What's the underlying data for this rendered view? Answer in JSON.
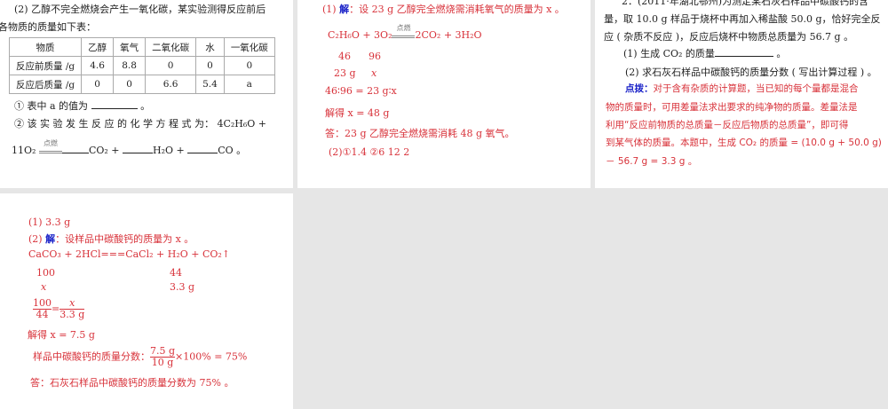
{
  "p1": {
    "intro": "(2) 乙醇不完全燃烧会产生一氧化碳，某实验测得反应前后",
    "intro2": "各物质的质量如下表：",
    "table": {
      "headers": [
        "物质",
        "乙醇",
        "氧气",
        "二氧化碳",
        "水",
        "一氧化碳"
      ],
      "rows": [
        [
          "反应前质量 /g",
          "4.6",
          "8.8",
          "0",
          "0",
          "0"
        ],
        [
          "反应后质量 /g",
          "0",
          "0",
          "6.6",
          "5.4",
          "a"
        ]
      ]
    },
    "q1": "① 表中  a  的值为",
    "q1_end": "。",
    "q2": "②  该  实  验  发  生  反  应  的  化  学  方  程  式  为：  4C₂H₆O  +",
    "cond": "点燃",
    "eq_start": "11O₂",
    "eq_co2": "CO₂ +",
    "eq_h2o": "H₂O +",
    "eq_co": "CO 。"
  },
  "p2": {
    "l1_pre": "(1) ",
    "l1_jie": "解",
    "l1": "：设  23 g  乙醇完全燃烧需消耗氧气的质量为  x 。",
    "eq_left": "C₂H₆O + 3O₂",
    "cond": "点燃",
    "eq_right": "2CO₂ + 3H₂O",
    "r1a": "46",
    "r1b": "96",
    "r2a": "23 g",
    "r2b": "x",
    "ratio": "46∶96 = 23 g∶x",
    "solve": "解得  x = 48 g",
    "ans": "答：23 g  乙醇完全燃烧需消耗  48 g  氧气。",
    "p2": "(2)①1.4    ②6    12    2"
  },
  "p3": {
    "l0": "2．(2011·年湖北鄂州)为测定某石灰石样品中碳酸钙的含",
    "l1": "量，取  10.0 g  样品于烧杯中再加入稀盐酸  50.0 g，恰好完全反",
    "l2": "应 ( 杂质不反应 )，反应后烧杯中物质总质量为  56.7 g 。",
    "q1": "(1) 生成  CO₂ 的质量",
    "q1_end": "。",
    "q2": "(2) 求石灰石样品中碳酸钙的质量分数 ( 写出计算过程 ) 。",
    "hint_label": "点拨：",
    "h1": "对于含有杂质的计算题，当已知的每个量都是混合",
    "h2": "物的质量时，可用差量法求出要求的纯净物的质量。差量法是",
    "h3": "利用“反应前物质的总质量－反应后物质的总质量”，即可得",
    "h4": "到某气体的质量。本题中，生成  CO₂ 的质量 = (10.0 g + 50.0 g)",
    "h5": "－ 56.7 g = 3.3 g 。"
  },
  "p4": {
    "l1": "(1) 3.3 g",
    "l2_pre": "(2) ",
    "l2_jie": "解",
    "l2": "：设样品中碳酸钙的质量为  x 。",
    "eq": "CaCO₃ + 2HCl===CaCl₂ + H₂O + CO₂↑",
    "r1a": "100",
    "r1b": "44",
    "r2a": "x",
    "r2b": "3.3 g",
    "f1n": "100",
    "f1d": "44",
    "eqs": "=",
    "f2n": "x",
    "f2d": "3.3 g",
    "solve": "解得  x = 7.5 g",
    "pct_label": "样品中碳酸钙的质量分数：",
    "f3n": "7.5 g",
    "f3d": "10 g",
    "pct_rest": "×100% = 75%",
    "ans": "答：石灰石样品中碳酸钙的质量分数为  75% 。"
  }
}
